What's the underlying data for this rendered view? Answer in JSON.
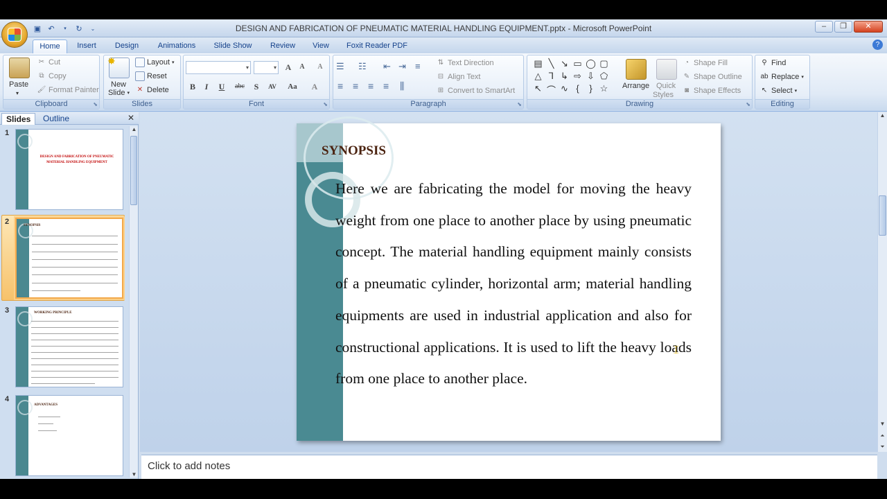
{
  "window": {
    "title": "DESIGN AND FABRICATION OF PNEUMATIC MATERIAL HANDLING EQUIPMENT.pptx - Microsoft PowerPoint",
    "minimize": "–",
    "restore": "❐",
    "close": "✕"
  },
  "tabs": [
    "Home",
    "Insert",
    "Design",
    "Animations",
    "Slide Show",
    "Review",
    "View",
    "Foxit Reader PDF"
  ],
  "ribbon": {
    "clipboard": {
      "label": "Clipboard",
      "paste": "Paste",
      "cut": "Cut",
      "copy": "Copy",
      "format_painter": "Format Painter"
    },
    "slides": {
      "label": "Slides",
      "new_slide_1": "New",
      "new_slide_2": "Slide",
      "layout": "Layout",
      "reset": "Reset",
      "delete": "Delete"
    },
    "font": {
      "label": "Font",
      "bold": "B",
      "italic": "I",
      "underline": "U",
      "strike": "abc",
      "shadow": "S",
      "spacing": "AV",
      "case": "Aa"
    },
    "paragraph": {
      "label": "Paragraph",
      "text_direction": "Text Direction",
      "align_text": "Align Text",
      "convert_smartart": "Convert to SmartArt"
    },
    "drawing": {
      "label": "Drawing",
      "arrange": "Arrange",
      "quick_styles_1": "Quick",
      "quick_styles_2": "Styles",
      "shape_fill": "Shape Fill",
      "shape_outline": "Shape Outline",
      "shape_effects": "Shape Effects"
    },
    "editing": {
      "label": "Editing",
      "find": "Find",
      "replace": "Replace",
      "select": "Select"
    }
  },
  "panel": {
    "tabs": [
      "Slides",
      "Outline"
    ],
    "thumbnails": [
      {
        "num": "1",
        "title": "DESIGN AND FABRICATION OF PNEUMATIC MATERIAL HANDLING EQUIPMENT"
      },
      {
        "num": "2",
        "title": "SYNOPSIS"
      },
      {
        "num": "3",
        "title": "WORKING PRINCIPLE"
      },
      {
        "num": "4",
        "title": "ADVANTAGES"
      }
    ]
  },
  "slide": {
    "title": "SYNOPSIS",
    "body": "Here we are fabricating the model for moving the heavy weight from one place to another place by using pneumatic concept. The material handling equipment mainly consists of a pneumatic cylinder, horizontal arm; material handling equipments are used in industrial application and also for constructional applications. It is used to lift the heavy loads from one place to another place."
  },
  "notes": {
    "placeholder": "Click to add notes"
  },
  "colors": {
    "slide_band": "#4a8a92",
    "slide_title": "#4b2310",
    "ribbon_text": "#15428b",
    "selected_thumb": "#f3a94b"
  }
}
